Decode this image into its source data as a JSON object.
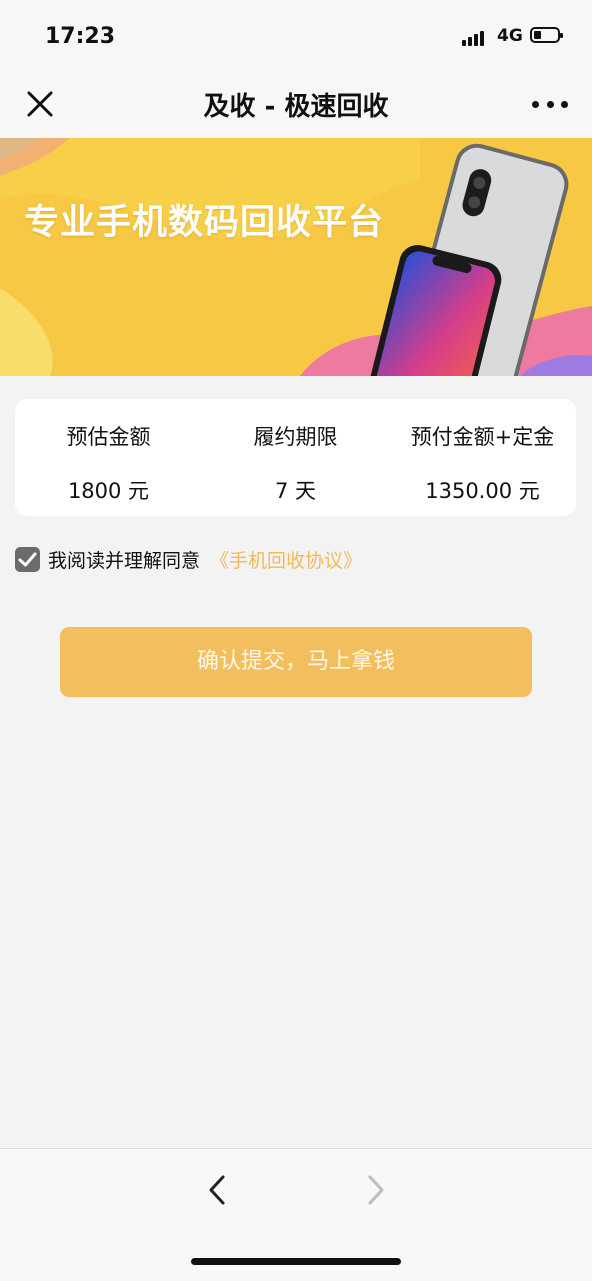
{
  "status_bar": {
    "time": "17:23",
    "network": "4G",
    "battery_level_fraction": 0.2
  },
  "nav": {
    "title": "及收 - 极速回收",
    "close_icon": "close-icon",
    "more_icon": "more-icon"
  },
  "banner": {
    "slogan": "专业手机数码回收平台"
  },
  "summary": {
    "items": [
      {
        "label": "预估金额",
        "value": "1800 元"
      },
      {
        "label": "履约期限",
        "value": "7 天"
      },
      {
        "label": "预付金额+定金",
        "value": "1350.00 元"
      }
    ]
  },
  "agreement": {
    "checked": true,
    "text": "我阅读并理解同意",
    "link": "《手机回收协议》"
  },
  "submit": {
    "label": "确认提交，马上拿钱"
  },
  "toolbar": {
    "back_icon": "chevron-left-icon",
    "forward_icon": "chevron-right-icon"
  },
  "colors": {
    "accent": "#f3bf5e",
    "link": "#f0ba5a",
    "background": "#f3f3f3"
  }
}
